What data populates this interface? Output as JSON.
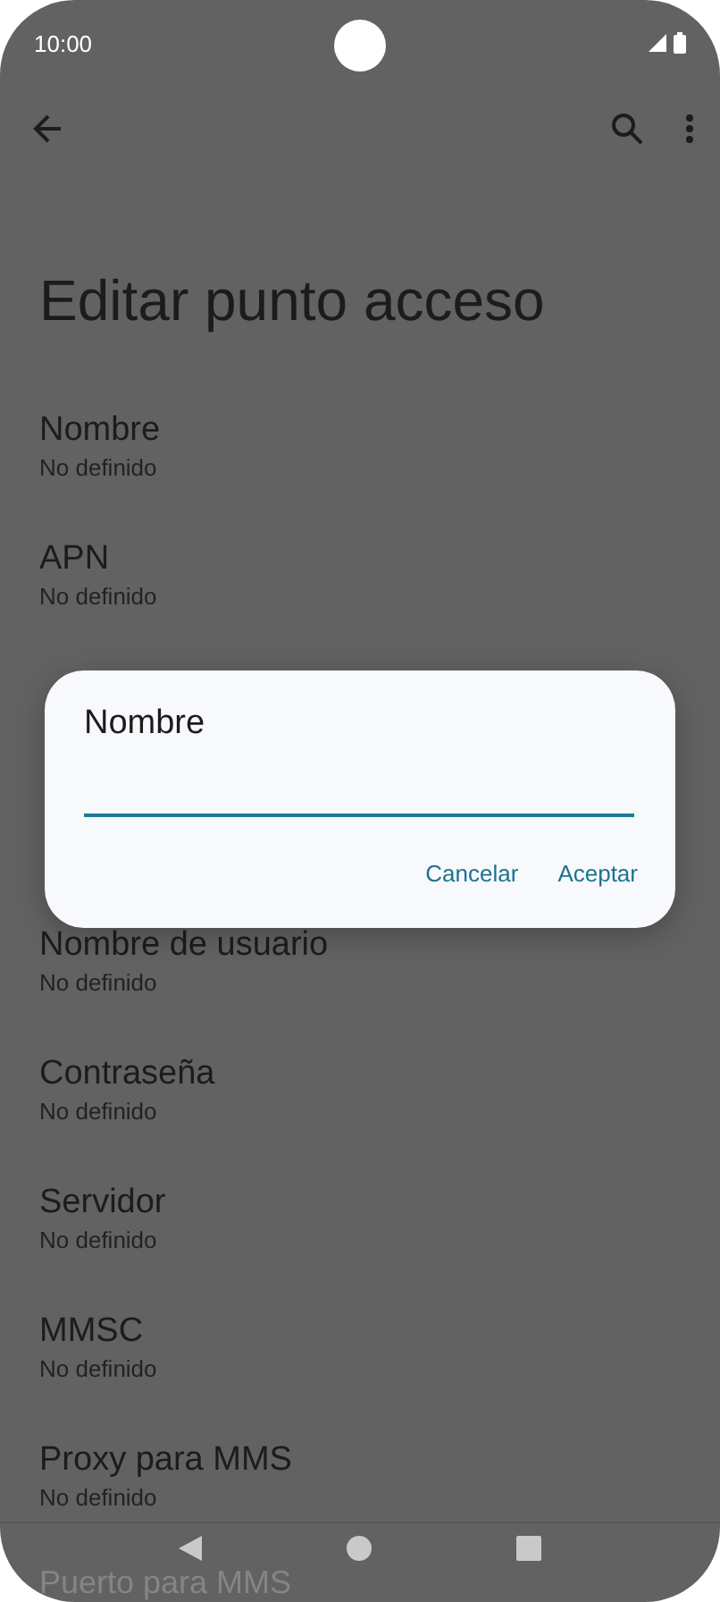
{
  "status_bar": {
    "time": "10:00"
  },
  "title": "Editar punto acceso",
  "settings": [
    {
      "label": "Nombre",
      "value": "No definido"
    },
    {
      "label": "APN",
      "value": "No definido"
    },
    {
      "label": "Nombre de usuario",
      "value": "No definido"
    },
    {
      "label": "Contraseña",
      "value": "No definido"
    },
    {
      "label": "Servidor",
      "value": "No definido"
    },
    {
      "label": "MMSC",
      "value": "No definido"
    },
    {
      "label": "Proxy para MMS",
      "value": "No definido"
    },
    {
      "label": "Puerto para MMS"
    }
  ],
  "dialog": {
    "title": "Nombre",
    "buttons": [
      "Cancelar",
      "Aceptar"
    ]
  }
}
